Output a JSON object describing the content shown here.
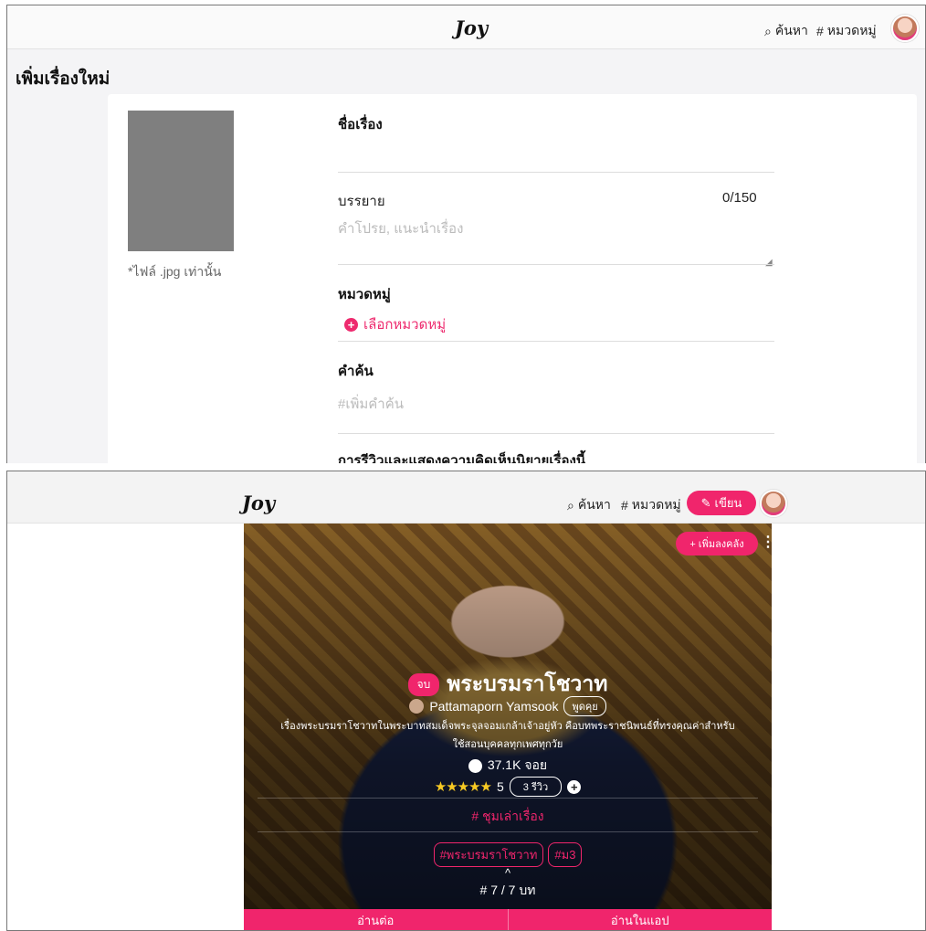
{
  "top": {
    "brand": "Joy",
    "nav": {
      "search": "ค้นหา",
      "category": "หมวดหมู่"
    },
    "page_title": "เพิ่มเรื่องใหม่",
    "cover_note": "*ไฟล์ .jpg เท่านั้น",
    "fields": {
      "title_label": "ชื่อเรื่อง",
      "desc_label": "บรรยาย",
      "desc_count": "0/150",
      "desc_placeholder": "คำโปรย, แนะนำเรื่อง",
      "category_label": "หมวดหมู่",
      "category_add": "เลือกหมวดหมู่",
      "keyword_label": "คำค้น",
      "keyword_placeholder": "#เพิ่มคำค้น",
      "review_label": "การรีวิวและแสดงความคิดเห็นนิยายเรื่องนี้"
    }
  },
  "bottom": {
    "brand": "Joy",
    "nav": {
      "search": "ค้นหา",
      "category": "หมวดหมู่",
      "write": "เขียน"
    },
    "library_button": "+ เพิ่มลงคลัง",
    "status_badge": "จบ",
    "story_title": "พระบรมราโชวาท",
    "author": "Pattamaporn Yamsook",
    "chat": "พูดคุย",
    "description": "เรื่องพระบรมราโชวาทในพระบาทสมเด็จพระจุลจอมเกล้าเจ้าอยู่หัว คือบทพระราชนิพนธ์ที่ทรงคุณค่าสำหรับใช้สอนบุคคลทุกเพศทุกวัย",
    "views": "37.1K จอย",
    "stars": "★★★★★",
    "rating": "5",
    "reviews": "3 รีวิว",
    "category": "# ชุมเล่าเรื่อง",
    "tags": [
      "#พระบรมราโชวาท",
      "#ม3"
    ],
    "chapter": "# 7 / 7 บท",
    "actions": {
      "continue": "อ่านต่อ",
      "in_app": "อ่านในแอป"
    }
  },
  "colors": {
    "accent": "#f0256c",
    "star": "#f7c923"
  }
}
